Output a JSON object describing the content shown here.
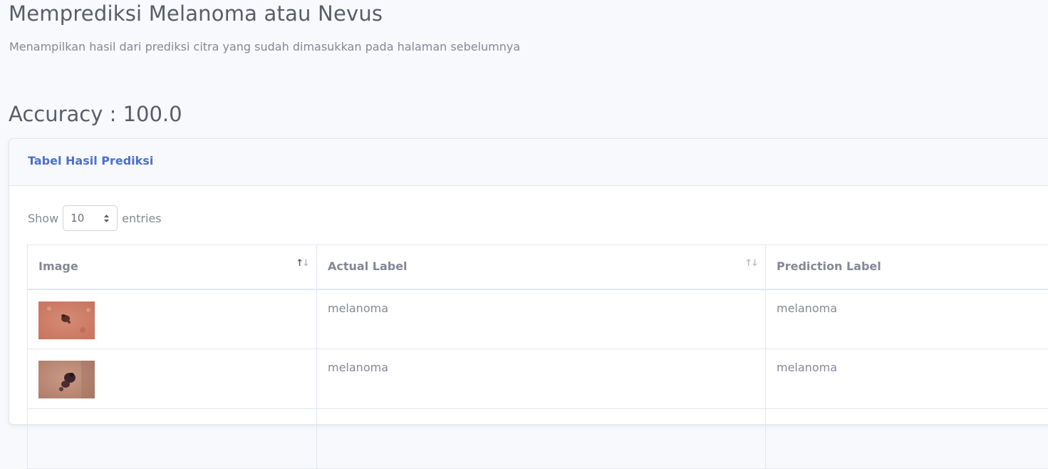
{
  "header": {
    "title": "Memprediksi Melanoma atau Nevus",
    "subtitle": "Menampilkan hasil dari prediksi citra yang sudah dimasukkan pada halaman sebelumnya",
    "accuracy": "Accuracy : 100.0"
  },
  "card": {
    "title": "Tabel Hasil Prediksi"
  },
  "length_menu": {
    "show_label": "Show",
    "selected": "10",
    "entries_label": "entries"
  },
  "table": {
    "columns": [
      "Image",
      "Actual Label",
      "Prediction Label"
    ],
    "rows": [
      {
        "image": "skin-lesion-thumbnail",
        "actual": "melanoma",
        "prediction": "melanoma"
      },
      {
        "image": "skin-lesion-thumbnail",
        "actual": "melanoma",
        "prediction": "melanoma"
      }
    ]
  },
  "colors": {
    "background": "#f8f9fc",
    "accent": "#4e73df",
    "text": "#5a5c69",
    "muted": "#858796",
    "border": "#e3e6f0"
  },
  "icons": {
    "sort": "sort-arrows-icon",
    "select": "select-updown-icon"
  }
}
